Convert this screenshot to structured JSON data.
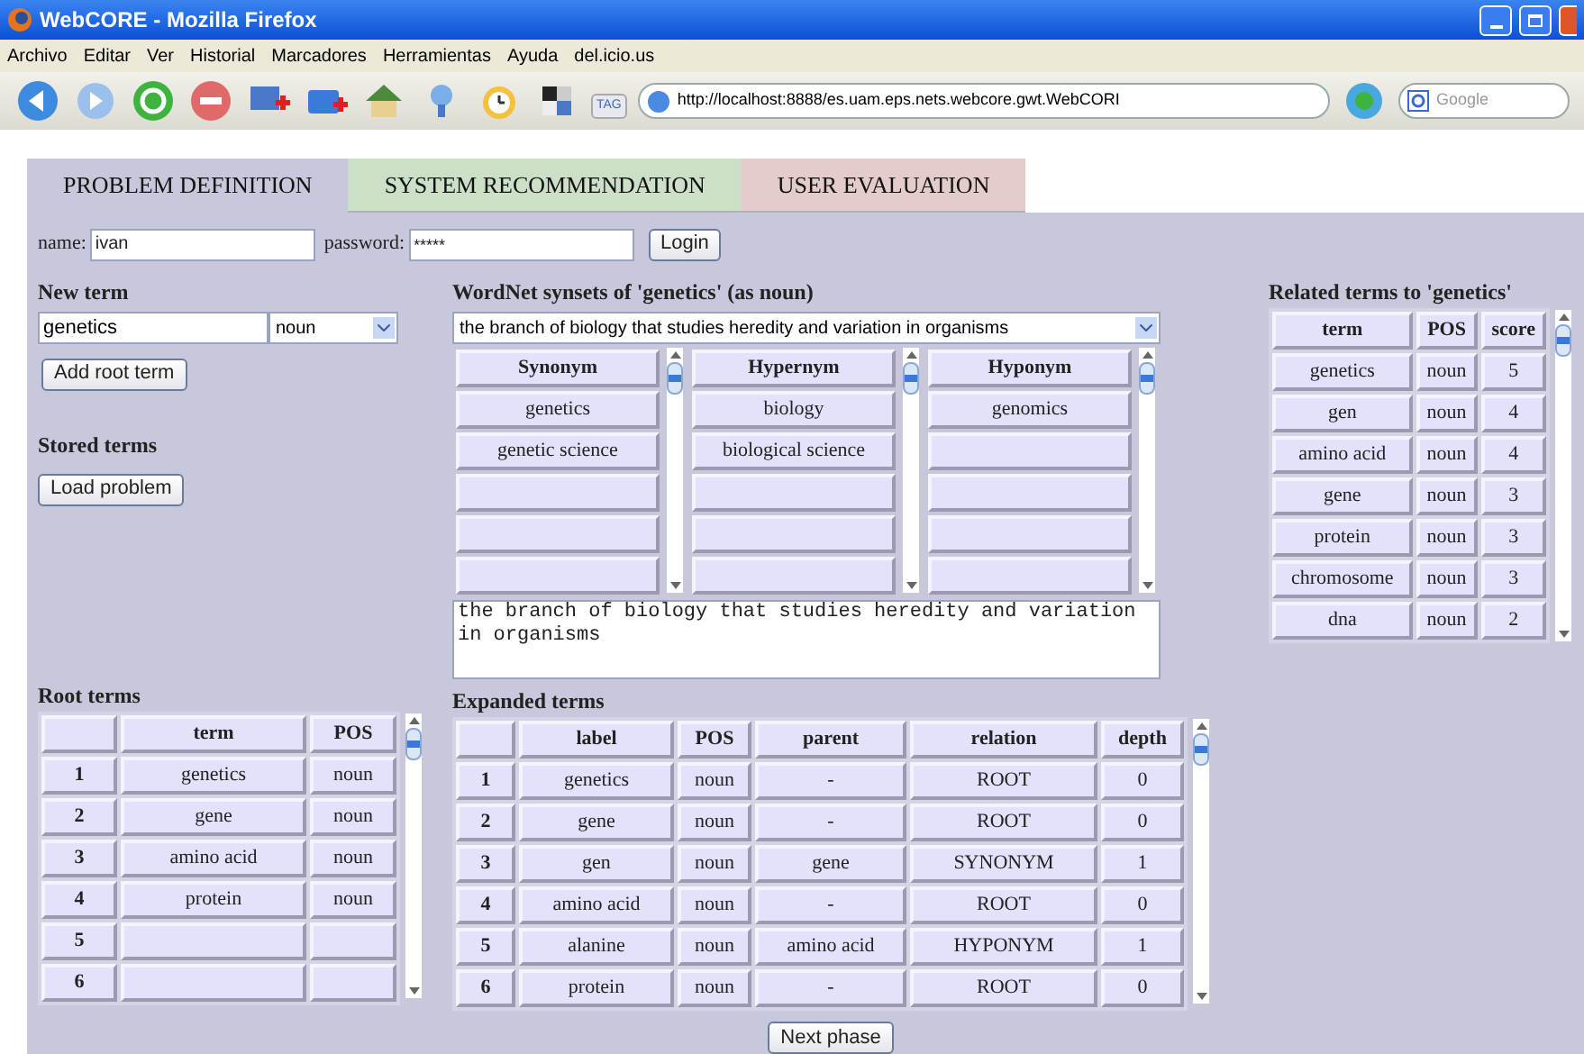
{
  "window": {
    "title": "WebCORE - Mozilla Firefox"
  },
  "menu": [
    "Archivo",
    "Editar",
    "Ver",
    "Historial",
    "Marcadores",
    "Herramientas",
    "Ayuda",
    "del.icio.us"
  ],
  "toolbar": {
    "tag_label": "TAG",
    "address": "http://localhost:8888/es.uam.eps.nets.webcore.gwt.WebCORI",
    "search_placeholder": "Google"
  },
  "tabs": [
    {
      "label": "PROBLEM DEFINITION",
      "selected": true,
      "color": "#c8c8dc"
    },
    {
      "label": "SYSTEM RECOMMENDATION",
      "selected": false,
      "color": "#cce0c8"
    },
    {
      "label": "USER EVALUATION",
      "selected": false,
      "color": "#e4cccc"
    }
  ],
  "login": {
    "name_label": "name:",
    "name_value": "ivan",
    "password_label": "password:",
    "password_value": "*****",
    "button": "Login"
  },
  "new_term": {
    "title": "New term",
    "value": "genetics",
    "pos": "noun",
    "button": "Add root term"
  },
  "stored_terms": {
    "title": "Stored terms",
    "button": "Load problem"
  },
  "wordnet": {
    "title": "WordNet synsets of 'genetics' (as noun)",
    "synset": "the branch of biology that studies heredity and variation in organisms",
    "lists": [
      {
        "header": "Synonym",
        "items": [
          "genetics",
          "genetic science"
        ]
      },
      {
        "header": "Hypernym",
        "items": [
          "biology",
          "biological science"
        ]
      },
      {
        "header": "Hyponym",
        "items": [
          "genomics"
        ]
      }
    ],
    "gloss": "the branch of biology that studies heredity and variation in organisms"
  },
  "related": {
    "title": "Related terms to 'genetics'",
    "columns": [
      "term",
      "POS",
      "score"
    ],
    "rows": [
      [
        "genetics",
        "noun",
        "5"
      ],
      [
        "gen",
        "noun",
        "4"
      ],
      [
        "amino acid",
        "noun",
        "4"
      ],
      [
        "gene",
        "noun",
        "3"
      ],
      [
        "protein",
        "noun",
        "3"
      ],
      [
        "chromosome",
        "noun",
        "3"
      ],
      [
        "dna",
        "noun",
        "2"
      ]
    ]
  },
  "root_terms": {
    "title": "Root terms",
    "columns": [
      "",
      "term",
      "POS"
    ],
    "rows": [
      [
        "1",
        "genetics",
        "noun"
      ],
      [
        "2",
        "gene",
        "noun"
      ],
      [
        "3",
        "amino acid",
        "noun"
      ],
      [
        "4",
        "protein",
        "noun"
      ],
      [
        "5",
        "",
        ""
      ],
      [
        "6",
        "",
        ""
      ]
    ]
  },
  "expanded": {
    "title": "Expanded terms",
    "columns": [
      "",
      "label",
      "POS",
      "parent",
      "relation",
      "depth"
    ],
    "rows": [
      [
        "1",
        "genetics",
        "noun",
        "-",
        "ROOT",
        "0"
      ],
      [
        "2",
        "gene",
        "noun",
        "-",
        "ROOT",
        "0"
      ],
      [
        "3",
        "gen",
        "noun",
        "gene",
        "SYNONYM",
        "1"
      ],
      [
        "4",
        "amino acid",
        "noun",
        "-",
        "ROOT",
        "0"
      ],
      [
        "5",
        "alanine",
        "noun",
        "amino acid",
        "HYPONYM",
        "1"
      ],
      [
        "6",
        "protein",
        "noun",
        "-",
        "ROOT",
        "0"
      ]
    ]
  },
  "next_button": "Next phase"
}
